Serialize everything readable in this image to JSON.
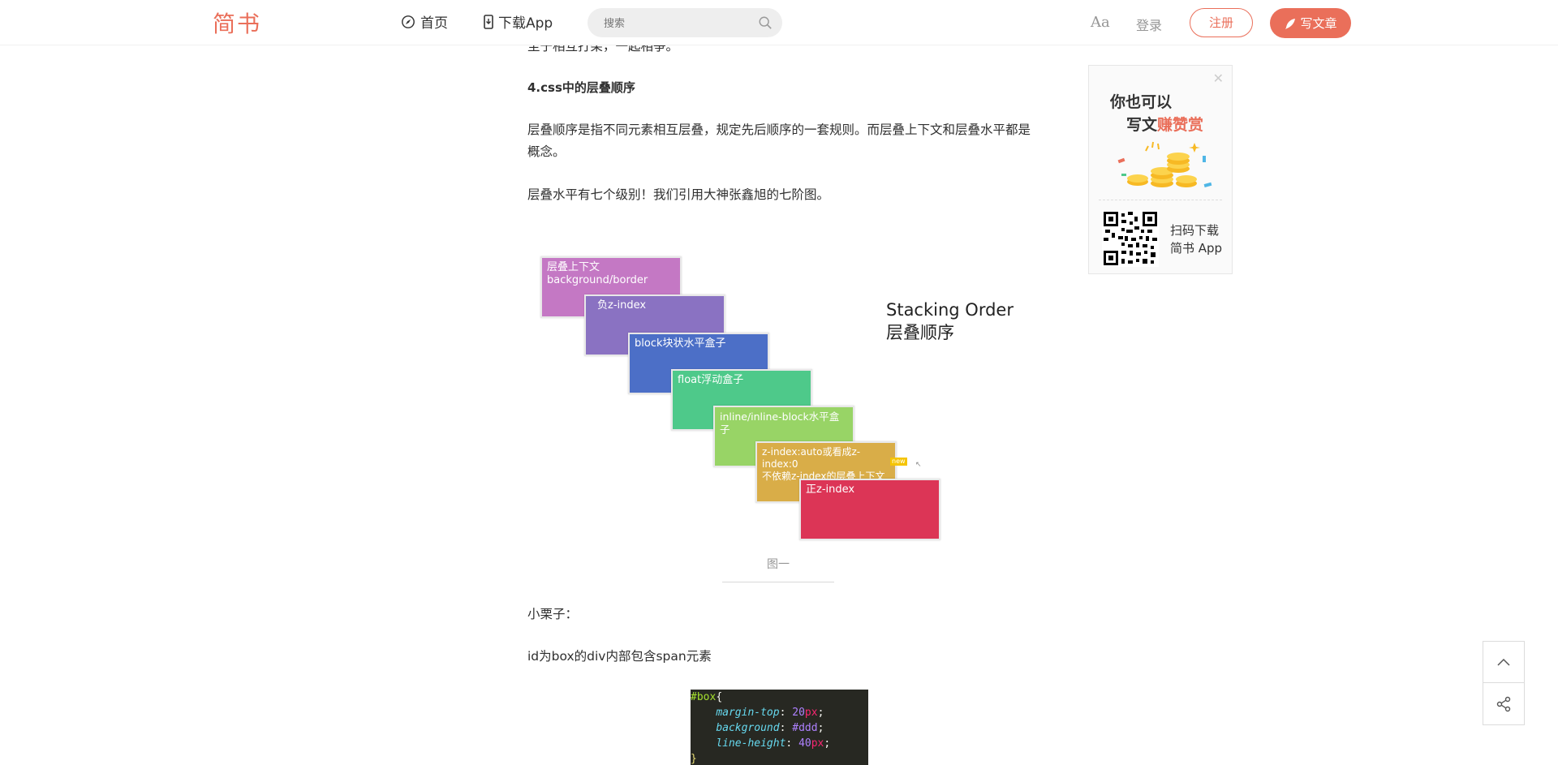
{
  "header": {
    "logo": "简书",
    "nav": {
      "home": "首页",
      "download": "下载App"
    },
    "search_placeholder": "搜索",
    "font_toggle": "Aa",
    "login": "登录",
    "register": "注册",
    "write": "写文章"
  },
  "article": {
    "cut_line": "至于相互打架，一起相争。",
    "heading": "4.css中的层叠顺序",
    "para1": "层叠顺序是指不同元素相互层叠，规定先后顺序的一套规则。而层叠上下文和层叠水平都是概念。",
    "para2": "层叠水平有七个级别！我们引用大神张鑫旭的七阶图。",
    "figure": {
      "title_en": "Stacking Order",
      "title_cn": "层叠顺序",
      "boxes": [
        {
          "label": "层叠上下文\nbackground/border",
          "color": "#c478c4"
        },
        {
          "label": "负z-index",
          "color": "#8a72c2"
        },
        {
          "label": "block块状水平盒子",
          "color": "#4c6fc7"
        },
        {
          "label": "float浮动盒子",
          "color": "#4ec98a"
        },
        {
          "label": "inline/inline-block水平盒子",
          "color": "#98d466"
        },
        {
          "label": "z-index:auto或看成z-index:0\n不依赖z-index的层叠上下文",
          "color": "#d9ad48"
        },
        {
          "label": "正z-index",
          "color": "#dc3556"
        }
      ],
      "badge": "new",
      "caption": "图一"
    },
    "para3": "小栗子：",
    "para4": "id为box的div内部包含span元素",
    "code": {
      "selector": "#box",
      "lines": [
        {
          "prop": "margin-top",
          "num": "20",
          "unit": "px"
        },
        {
          "prop": "background",
          "num": "#ddd",
          "unit": ""
        },
        {
          "prop": "line-height",
          "num": "40",
          "unit": "px"
        }
      ]
    }
  },
  "ad": {
    "line1": "你也可以",
    "line2_prefix": "写文",
    "line2_highlight": "赚赞赏",
    "download_line1": "扫码下载",
    "download_line2": "简书 App"
  },
  "colors": {
    "brand": "#ea6f5a"
  }
}
